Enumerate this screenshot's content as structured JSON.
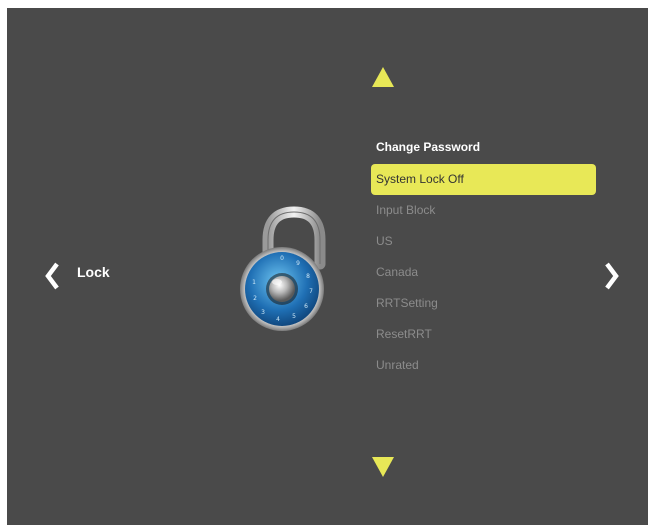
{
  "section": {
    "title": "Lock"
  },
  "menu": {
    "header": "Change Password",
    "items": [
      {
        "label": "System Lock Off",
        "selected": true
      },
      {
        "label": "Input Block",
        "selected": false
      },
      {
        "label": "US",
        "selected": false
      },
      {
        "label": "Canada",
        "selected": false
      },
      {
        "label": "RRTSetting",
        "selected": false
      },
      {
        "label": "ResetRRT",
        "selected": false
      },
      {
        "label": "Unrated",
        "selected": false
      }
    ]
  },
  "icons": {
    "left": "chevron-left-icon",
    "right": "chevron-right-icon",
    "up": "triangle-up-icon",
    "down": "triangle-down-icon",
    "lock": "padlock-icon"
  },
  "colors": {
    "background": "#4a4a4a",
    "accent": "#e8e857",
    "item_text": "#8c8c8c",
    "header_text": "#ffffff"
  }
}
